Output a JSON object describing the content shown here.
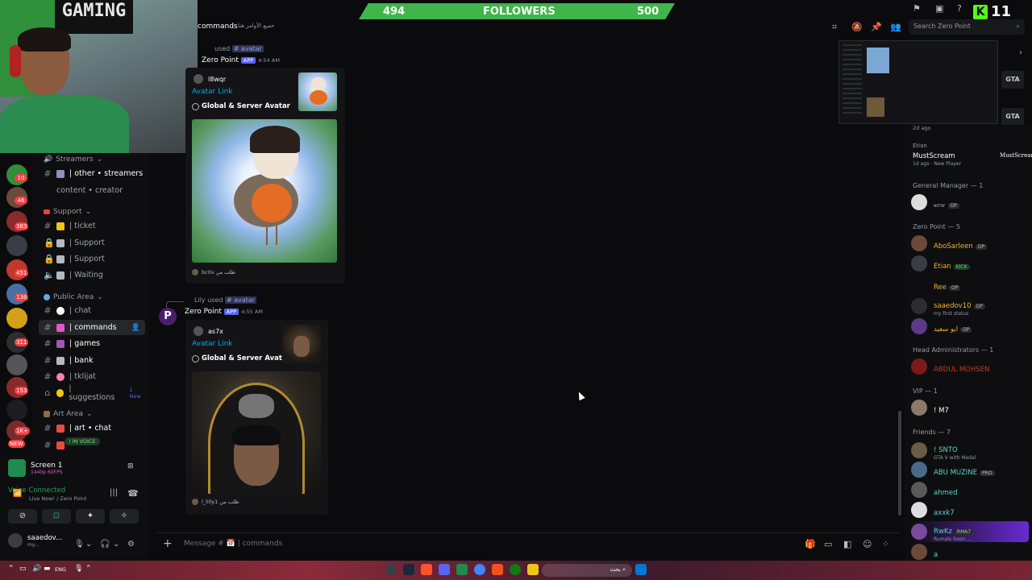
{
  "overlay": {
    "followers_current": "494",
    "followers_label": "FOLLOWERS",
    "followers_goal": "500",
    "kick_count": "11",
    "webcam_poster_text": "GAMING",
    "kick_logo": "K"
  },
  "header": {
    "channel": "commands",
    "topic": "جميع الأوامر هنا",
    "search_placeholder": "Search Zero Point"
  },
  "sidebar": {
    "categories": {
      "streamers": "Streamers",
      "support": "Support",
      "public": "Public Area",
      "art": "Art Area"
    },
    "channels": [
      {
        "label": "| other • streamers"
      },
      {
        "label": "content • creator"
      },
      {
        "label": "| ticket"
      },
      {
        "label": "| Support"
      },
      {
        "label": "| Support"
      },
      {
        "label": "| Waiting"
      },
      {
        "label": "| chat"
      },
      {
        "label": "| commands"
      },
      {
        "label": "| games"
      },
      {
        "label": "| bank"
      },
      {
        "label": "| tklijat"
      },
      {
        "label": "| suggestions"
      },
      {
        "label": "| art • chat"
      }
    ],
    "new_tag": "1 New",
    "in_voice": "! IN VOICE",
    "rail_badges": [
      "10",
      "46",
      "383",
      "451",
      "136",
      "311",
      "153",
      "1K+",
      "NEW"
    ]
  },
  "voice_panel": {
    "screen_title": "Screen 1",
    "screen_sub": "1440p 60FPS",
    "connected": "Voice Connected",
    "sub": "Live Now! / Zero Point",
    "username": "saaedov...",
    "user_status": "my..."
  },
  "messages": [
    {
      "used_prefix": "used",
      "command": "# avatar",
      "bot": "Zero Point",
      "app_tag": "APP",
      "time": "4:54 AM",
      "embed_user": "l8wqr",
      "link_text": "Avatar Link",
      "kind": "Global & Server Avatar",
      "footer": "bc0v طلب من"
    },
    {
      "invoker": "Lily",
      "used_prefix": "used",
      "command": "# avatar",
      "bot": "Zero Point",
      "bot_initial": "P",
      "app_tag": "APP",
      "time": "4:55 AM",
      "embed_user": "as7x",
      "link_text": "Avatar Link",
      "kind": "Global & Server Avatar",
      "footer": "l_lilly1 طلب من"
    }
  ],
  "input": {
    "placeholder": "Message # 📅 | commands"
  },
  "members": {
    "top_time": "2d ago",
    "etian_game": "Etian",
    "etian_app": "MustScream",
    "etian_status": "1d ago · New Player",
    "groups": [
      {
        "label": "General Manager — 1"
      },
      {
        "label": "Zero Point — 5"
      },
      {
        "label": "Head Administrators — 1"
      },
      {
        "label": "VIP — 1"
      },
      {
        "label": "Friends — 7"
      }
    ],
    "list": [
      {
        "name": "error",
        "color": "#b5bac1"
      },
      {
        "name": "AboSarleen",
        "color": "#f0b232"
      },
      {
        "name": "Etian",
        "color": "#f0b232",
        "tag": "KICK"
      },
      {
        "name": "Ree",
        "color": "#f0b232"
      },
      {
        "name": "saaedov10",
        "color": "#f0b232",
        "status": "my first status"
      },
      {
        "name": "ابو سعيد",
        "color": "#f0b232"
      },
      {
        "name": "ABDUL MOHSEN",
        "color": "#c0392b"
      },
      {
        "name": "! M7",
        "color": "#ffffff"
      },
      {
        "name": "! SNTO",
        "color": "#5dd6c7",
        "status": "GTA V with Medal"
      },
      {
        "name": "ABU MUZINE",
        "color": "#5dd6c7",
        "tag": "PRO"
      },
      {
        "name": "ahmed",
        "color": "#5dd6c7"
      },
      {
        "name": "axxk7",
        "color": "#5dd6c7"
      },
      {
        "name": "RwKz",
        "color": "#5dd6c7",
        "tag": "RMA7",
        "status": "Rumals Soon ..."
      },
      {
        "name": "a",
        "color": "#5dd6c7"
      }
    ],
    "op_tag": "OP",
    "gta_label": "GTA"
  },
  "taskbar": {
    "lang": "ENG",
    "search": "بحث"
  },
  "colors": {
    "accent": "#5865f2",
    "follower_bar": "#3fb54a",
    "link": "#00a8fc",
    "voice_green": "#23a55a"
  }
}
